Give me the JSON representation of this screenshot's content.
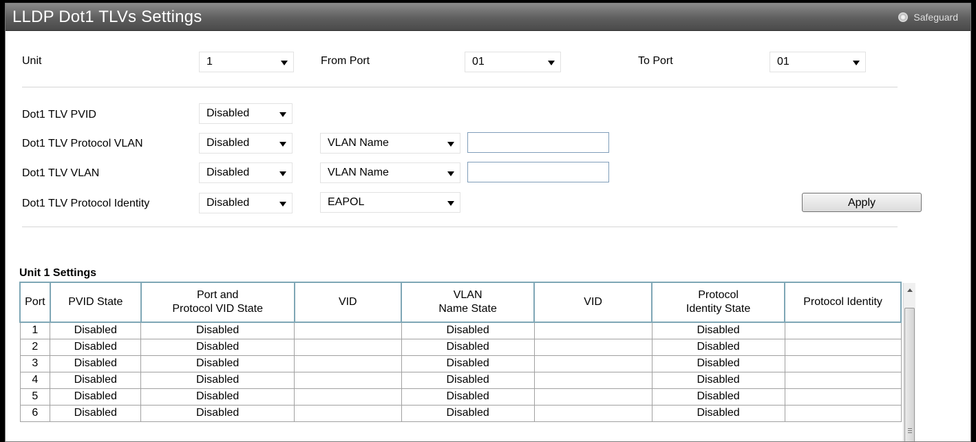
{
  "window": {
    "title": "LLDP Dot1 TLVs Settings",
    "safeguard": "Safeguard"
  },
  "port_range": {
    "unit_label": "Unit",
    "unit_value": "1",
    "from_port_label": "From Port",
    "from_port_value": "01",
    "to_port_label": "To Port",
    "to_port_value": "01"
  },
  "settings": {
    "pvid_label": "Dot1 TLV PVID",
    "pvid_value": "Disabled",
    "protocol_vlan_label": "Dot1 TLV Protocol VLAN",
    "protocol_vlan_value": "Disabled",
    "protocol_vlan_type": "VLAN Name",
    "protocol_vlan_input": "",
    "vlan_label": "Dot1 TLV VLAN",
    "vlan_value": "Disabled",
    "vlan_type": "VLAN Name",
    "vlan_input": "",
    "protocol_identity_label": "Dot1 TLV Protocol Identity",
    "protocol_identity_value": "Disabled",
    "protocol_identity_type": "EAPOL",
    "apply_label": "Apply"
  },
  "table": {
    "title": "Unit 1 Settings",
    "headers": {
      "port": "Port",
      "pvid_state": "PVID State",
      "ppvid_state_1": "Port and",
      "ppvid_state_2": "Protocol VID State",
      "vid": "VID",
      "vlan_name_state_1": "VLAN",
      "vlan_name_state_2": "Name State",
      "vid2": "VID",
      "pi_state_1": "Protocol",
      "pi_state_2": "Identity State",
      "protocol_identity": "Protocol Identity"
    },
    "rows": [
      {
        "port": "1",
        "pvid": "Disabled",
        "ppvid": "Disabled",
        "vid": "",
        "vlan_name": "Disabled",
        "vid2": "",
        "pi_state": "Disabled",
        "pi": ""
      },
      {
        "port": "2",
        "pvid": "Disabled",
        "ppvid": "Disabled",
        "vid": "",
        "vlan_name": "Disabled",
        "vid2": "",
        "pi_state": "Disabled",
        "pi": ""
      },
      {
        "port": "3",
        "pvid": "Disabled",
        "ppvid": "Disabled",
        "vid": "",
        "vlan_name": "Disabled",
        "vid2": "",
        "pi_state": "Disabled",
        "pi": ""
      },
      {
        "port": "4",
        "pvid": "Disabled",
        "ppvid": "Disabled",
        "vid": "",
        "vlan_name": "Disabled",
        "vid2": "",
        "pi_state": "Disabled",
        "pi": ""
      },
      {
        "port": "5",
        "pvid": "Disabled",
        "ppvid": "Disabled",
        "vid": "",
        "vlan_name": "Disabled",
        "vid2": "",
        "pi_state": "Disabled",
        "pi": ""
      },
      {
        "port": "6",
        "pvid": "Disabled",
        "ppvid": "Disabled",
        "vid": "",
        "vlan_name": "Disabled",
        "vid2": "",
        "pi_state": "Disabled",
        "pi": ""
      }
    ]
  }
}
